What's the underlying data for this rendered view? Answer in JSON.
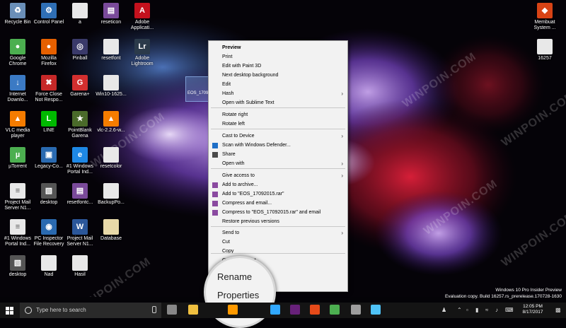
{
  "desktop_icons": [
    {
      "label": "Recycle Bin",
      "icon": "recycle-bin-icon",
      "color": "#6a8fb8"
    },
    {
      "label": "Control Panel",
      "icon": "control-panel-icon",
      "color": "#2f6fb5"
    },
    {
      "label": "a",
      "icon": "file-icon",
      "color": "#e8e8e8"
    },
    {
      "label": "reseticon",
      "icon": "winrar-icon",
      "color": "#7a4a9a"
    },
    {
      "label": "Adobe Applicati...",
      "icon": "adobe-icon",
      "color": "#c4111d"
    },
    {
      "label": "Google Chrome",
      "icon": "chrome-icon",
      "color": "#4caf50"
    },
    {
      "label": "Mozilla Firefox",
      "icon": "firefox-icon",
      "color": "#e66000"
    },
    {
      "label": "Pinball",
      "icon": "pinball-icon",
      "color": "#3a3a6a"
    },
    {
      "label": "resetfont",
      "icon": "file-icon",
      "color": "#e8e8e8"
    },
    {
      "label": "Adobe Lightroom",
      "icon": "lightroom-icon",
      "color": "#2b3a4a"
    },
    {
      "label": "Internet Downlo...",
      "icon": "idm-icon",
      "color": "#3b7ac4"
    },
    {
      "label": "Force Close Not Respo...",
      "icon": "force-close-icon",
      "color": "#c62828"
    },
    {
      "label": "Garena+",
      "icon": "garena-icon",
      "color": "#d32f2f"
    },
    {
      "label": "Win10-1625...",
      "icon": "file-icon",
      "color": "#e8e8e8"
    },
    {
      "label": "VLC media player",
      "icon": "vlc-icon",
      "color": "#f57c00"
    },
    {
      "label": "LINE",
      "icon": "line-icon",
      "color": "#00b900"
    },
    {
      "label": "PointBlank Garena",
      "icon": "pointblank-icon",
      "color": "#4a6a2a"
    },
    {
      "label": "vlc-2.2.6-w...",
      "icon": "vlc-icon",
      "color": "#f57c00"
    },
    {
      "label": "µTorrent",
      "icon": "utorrent-icon",
      "color": "#4caf50"
    },
    {
      "label": "Legacy-Co...",
      "icon": "shortcut-icon",
      "color": "#2a6ab0"
    },
    {
      "label": "#1 Windows Portal Ind...",
      "icon": "ie-icon",
      "color": "#1e88e5"
    },
    {
      "label": "resetcolor",
      "icon": "file-icon",
      "color": "#e8e8e8"
    },
    {
      "label": "Project Mail Server N1...",
      "icon": "document-icon",
      "color": "#e8e8e8"
    },
    {
      "label": "desktop",
      "icon": "image-icon",
      "color": "#555555"
    },
    {
      "label": "resetfontc...",
      "icon": "winrar-icon",
      "color": "#7a4a9a"
    },
    {
      "label": "BackupPo...",
      "icon": "file-icon",
      "color": "#e8e8e8"
    },
    {
      "label": "#1 Windows Portal Ind...",
      "icon": "document-icon",
      "color": "#e8e8e8"
    },
    {
      "label": "PC Inspector File Recovery",
      "icon": "pc-inspector-icon",
      "color": "#2a6ab0"
    },
    {
      "label": "Project Mail Server N1...",
      "icon": "word-icon",
      "color": "#2b579a"
    },
    {
      "label": "Database",
      "icon": "file-icon",
      "color": "#e8d9a8"
    },
    {
      "label": "desktop",
      "icon": "image-icon",
      "color": "#555555"
    },
    {
      "label": "Nad",
      "icon": "file-icon",
      "color": "#e8e8e8"
    },
    {
      "label": "Hasil",
      "icon": "file-icon",
      "color": "#e8e8e8"
    },
    {
      "label": "Membuat System ...",
      "icon": "shield-icon",
      "color": "#d84315"
    },
    {
      "label": "16257",
      "icon": "file-icon",
      "color": "#e8e8e8"
    }
  ],
  "selected_file": {
    "label": "EOS_1709..."
  },
  "watermark_text": "WINPOIN.COM",
  "context_menu": {
    "items": [
      {
        "label": "Preview",
        "bold": true
      },
      {
        "label": "Print"
      },
      {
        "label": "Edit with Paint 3D"
      },
      {
        "label": "Next desktop background"
      },
      {
        "label": "Edit"
      },
      {
        "label": "Hash",
        "submenu": true
      },
      {
        "label": "Open with Sublime Text"
      },
      {
        "label": "Rotate right"
      },
      {
        "label": "Rotate left"
      },
      {
        "label": "Cast to Device",
        "submenu": true
      },
      {
        "label": "Scan with Windows Defender...",
        "icon": "defender-icon"
      },
      {
        "label": "Share",
        "icon": "share-icon"
      },
      {
        "label": "Open with",
        "submenu": true
      },
      {
        "label": "Give access to",
        "submenu": true
      },
      {
        "label": "Add to archive...",
        "icon": "winrar-icon"
      },
      {
        "label": "Add to \"EOS_17092015.rar\"",
        "icon": "winrar-icon"
      },
      {
        "label": "Compress and email...",
        "icon": "winrar-icon"
      },
      {
        "label": "Compress to \"EOS_17092015.rar\" and email",
        "icon": "winrar-icon"
      },
      {
        "label": "Restore previous versions"
      },
      {
        "label": "Send to",
        "submenu": true
      },
      {
        "label": "Cut"
      },
      {
        "label": "Copy"
      },
      {
        "label": "Create shortcut"
      }
    ],
    "zoom_items": [
      "Rename",
      "Properties"
    ]
  },
  "taskbar": {
    "search_placeholder": "Type here to search",
    "apps": [
      "task-view-icon",
      "file-explorer-icon",
      "illustrator-icon",
      "photoshop-icon",
      "visual-studio-icon",
      "power-icon",
      "chrome-icon",
      "network-icon",
      "screenshot-icon"
    ],
    "app_colors": [
      "#888888",
      "#f0c040",
      "#ff9a00",
      "#31a8ff",
      "#68217a",
      "#e64a19",
      "#4caf50",
      "#9e9e9e",
      "#4fc3f7"
    ],
    "clock_time": "12:05 PM",
    "clock_date": "8/17/2017"
  },
  "build_info": {
    "line1": "Windows 10 Pro Insider Preview",
    "line2": "Evaluation copy. Build 16257.rs_prerelease.170728-1630"
  }
}
